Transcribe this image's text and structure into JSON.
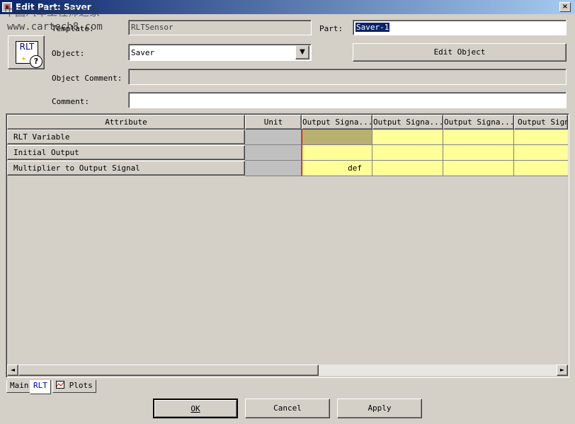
{
  "window": {
    "title": "Edit Part: Saver",
    "close_label": "×",
    "icon_label": "▣"
  },
  "watermark": {
    "line1": "中国汽车工程师之家",
    "line2": "www.cartech8.com"
  },
  "form": {
    "icon": {
      "name": "rlt-part-icon",
      "text": "RLT",
      "badge": "?",
      "star": "✦"
    },
    "template_label": "Template:",
    "template_value": "RLTSensor",
    "part_label": "Part:",
    "part_value": "Saver-1",
    "object_label": "Object:",
    "object_value": "Saver",
    "object_dropdown_icon": "▼",
    "edit_object_label": "Edit Object",
    "object_comment_label": "Object Comment:",
    "object_comment_value": "",
    "comment_label": "Comment:",
    "comment_value": ""
  },
  "grid": {
    "columns": [
      "Attribute",
      "Unit",
      "Output Signa...",
      "Output Signa...",
      "Output Signa...",
      "Output Signa"
    ],
    "rows": [
      {
        "attribute": "RLT Variable",
        "unit": "",
        "values": [
          "",
          "",
          "",
          ""
        ]
      },
      {
        "attribute": "Initial Output",
        "unit": "",
        "values": [
          "",
          "",
          "",
          ""
        ]
      },
      {
        "attribute": "Multiplier to Output Signal",
        "unit": "",
        "values": [
          "def",
          "",
          "",
          ""
        ]
      }
    ]
  },
  "scrollbar": {
    "left_arrow": "◄",
    "right_arrow": "►"
  },
  "tabs": [
    {
      "label": "Main",
      "active": false
    },
    {
      "label": "RLT",
      "active": true
    },
    {
      "label": "Plots",
      "active": false,
      "icon": "plot-icon"
    }
  ],
  "buttons": {
    "ok": {
      "label": "OK"
    },
    "cancel": {
      "label": "Cancel"
    },
    "apply": {
      "label": "Apply"
    }
  },
  "colors": {
    "title_start": "#0a246a",
    "title_end": "#a6caf0",
    "face": "#d4d0c8",
    "cell_yellow": "#ffff99",
    "cell_selected": "#b8b070",
    "unit_gray": "#c0c0c0"
  }
}
